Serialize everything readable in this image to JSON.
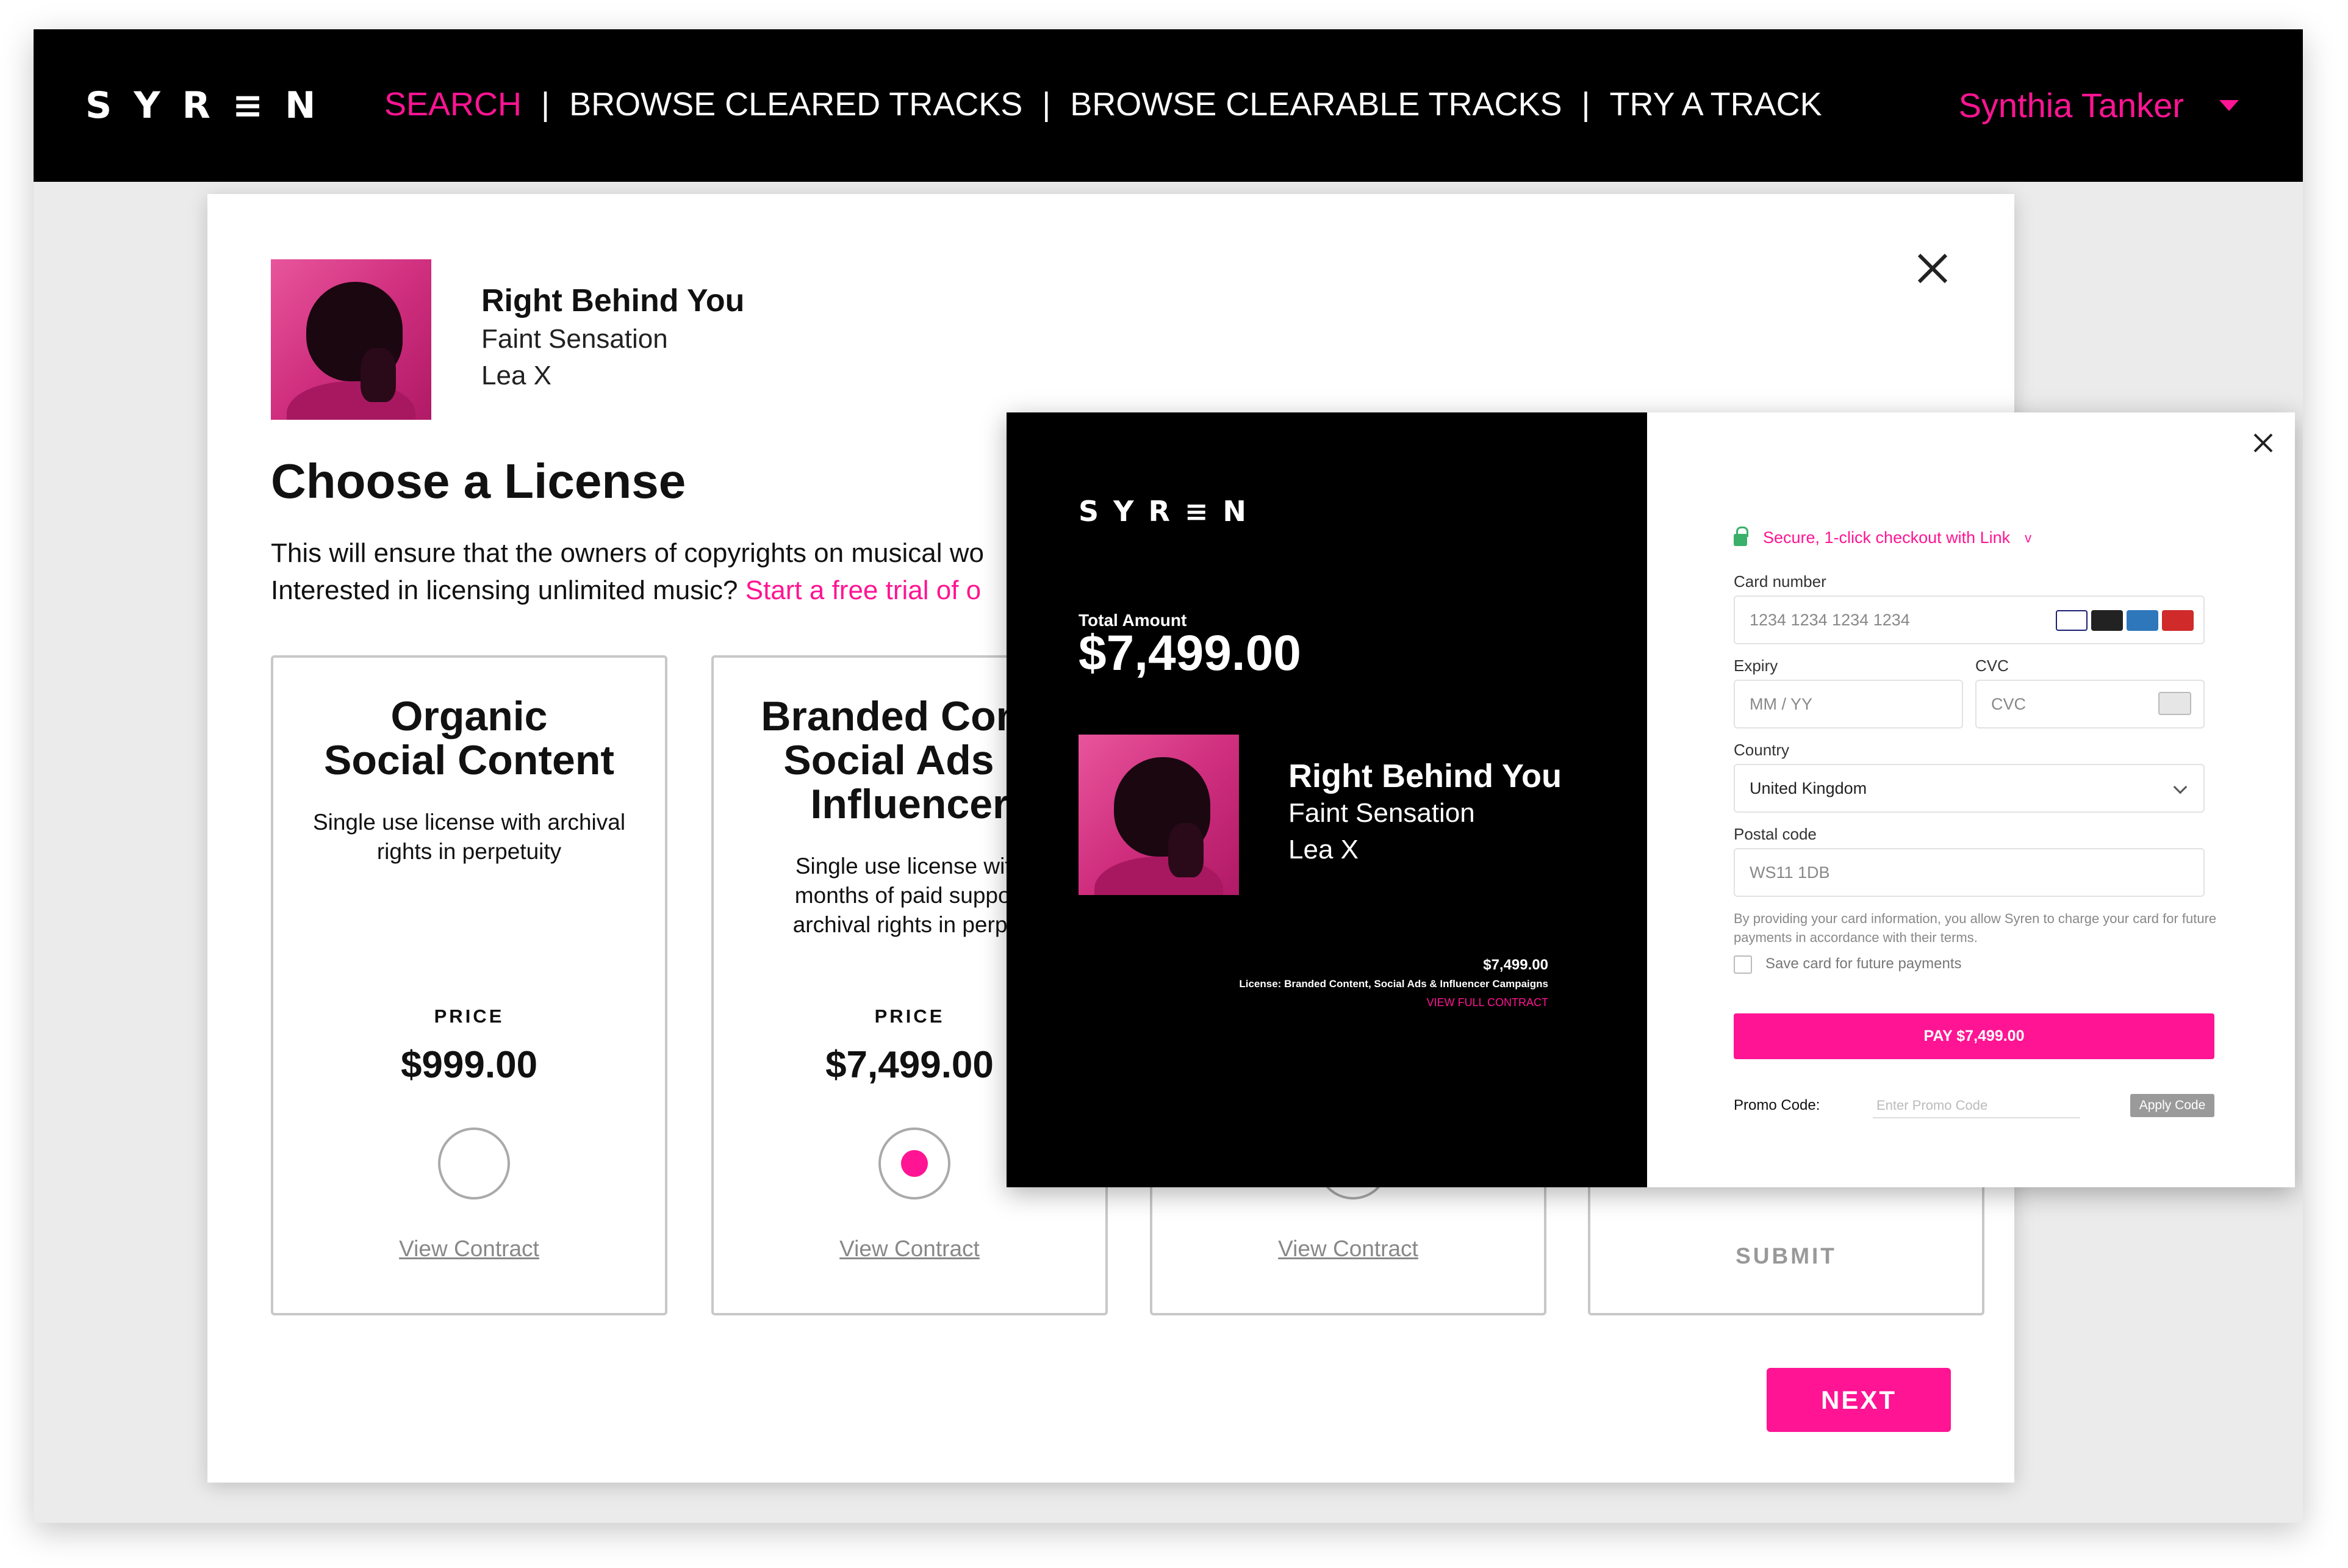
{
  "nav": {
    "logo": "SYR≡N",
    "links": [
      "SEARCH",
      "BROWSE CLEARED TRACKS",
      "BROWSE CLEARABLE TRACKS",
      "TRY A TRACK"
    ],
    "separator": "|",
    "user": "Synthia Tanker"
  },
  "track": {
    "title": "Right Behind You",
    "artist": "Faint Sensation",
    "label": "Lea X"
  },
  "license": {
    "heading": "Choose a License",
    "desc_line1": "This will ensure that the owners of copyrights on musical wo",
    "desc_line2": "Interested in licensing unlimited music?",
    "desc_link": "Start a free trial of o",
    "price_label": "PRICE",
    "view_contract": "View Contract",
    "cards": [
      {
        "title1": "Organic",
        "title2": "Social Content",
        "title3": "",
        "desc1": "Single use license with archival",
        "desc2": "rights in perpetuity",
        "desc3": "",
        "price": "$999.00"
      },
      {
        "title1": "Branded Conte",
        "title2": "Social Ads &",
        "title3": "Influencer",
        "desc1": "Single use license with",
        "desc2": "months of paid support",
        "desc3": "archival rights in perpet",
        "price": "$7,499.00"
      }
    ],
    "submit": "SUBMIT",
    "next": "NEXT"
  },
  "checkout": {
    "logo": "SYR≡N",
    "total_label": "Total Amount",
    "total": "$7,499.00",
    "summary_price": "$7,499.00",
    "summary_license_prefix": "License:",
    "summary_license": "Branded Content, Social Ads & Influencer Campaigns",
    "view_full": "VIEW FULL CONTRACT",
    "secure": "Secure, 1-click checkout with Link",
    "card_number_label": "Card number",
    "card_number_ph": "1234 1234 1234 1234",
    "expiry_label": "Expiry",
    "expiry_ph": "MM / YY",
    "cvc_label": "CVC",
    "cvc_ph": "CVC",
    "country_label": "Country",
    "country": "United Kingdom",
    "postal_label": "Postal code",
    "postal": "WS11 1DB",
    "terms": "By providing your card information, you allow Syren to charge your card for future payments in accordance with their terms.",
    "save_card": "Save card for future payments",
    "pay": "PAY $7,499.00",
    "promo_label": "Promo Code:",
    "promo_ph": "Enter Promo Code",
    "apply": "Apply Code"
  },
  "colors": {
    "accent": "#ff1493",
    "nav_bg": "#000000",
    "secure_green": "#3ab06a"
  }
}
